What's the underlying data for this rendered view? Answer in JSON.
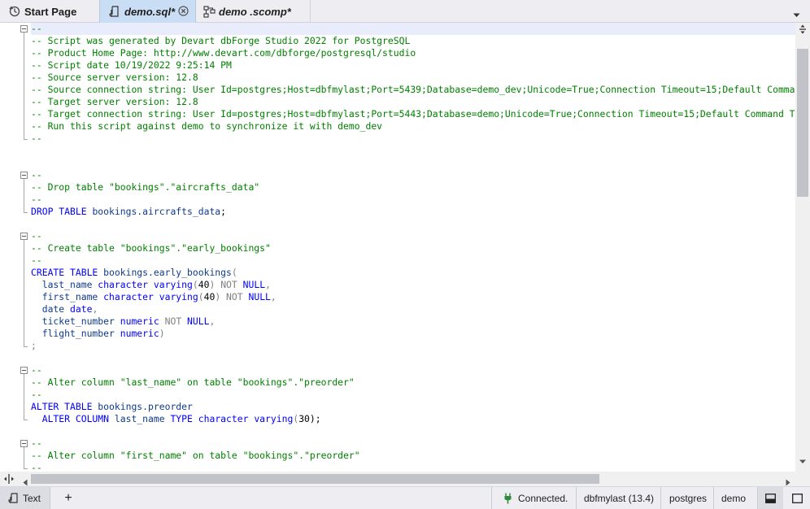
{
  "tabs": [
    {
      "label": "Start Page",
      "icon": "start-page-icon"
    },
    {
      "label": "demo.sql*",
      "icon": "sql-document-icon",
      "active": true
    },
    {
      "label": "demo .scomp*",
      "icon": "schema-compare-icon"
    }
  ],
  "editor": {
    "lines": [
      [
        {
          "t": "--",
          "c": "cm"
        }
      ],
      [
        {
          "t": "-- Script was generated by Devart dbForge Studio 2022 for PostgreSQL",
          "c": "cm"
        }
      ],
      [
        {
          "t": "-- Product Home Page: http://www.devart.com/dbforge/postgresql/studio",
          "c": "cm"
        }
      ],
      [
        {
          "t": "-- Script date 10/19/2022 9:25:14 PM",
          "c": "cm"
        }
      ],
      [
        {
          "t": "-- Source server version: 12.8",
          "c": "cm"
        }
      ],
      [
        {
          "t": "-- Source connection string: User Id=postgres;Host=dbfmylast;Port=5439;Database=demo_dev;Unicode=True;Connection Timeout=15;Default Comman",
          "c": "cm"
        }
      ],
      [
        {
          "t": "-- Target server version: 12.8",
          "c": "cm"
        }
      ],
      [
        {
          "t": "-- Target connection string: User Id=postgres;Host=dbfmylast;Port=5443;Database=demo;Unicode=True;Connection Timeout=15;Default Command Ti",
          "c": "cm"
        }
      ],
      [
        {
          "t": "-- Run this script against demo to synchronize it with demo_dev",
          "c": "cm"
        }
      ],
      [
        {
          "t": "--",
          "c": "cm"
        }
      ],
      [],
      [],
      [
        {
          "t": "--",
          "c": "cm"
        }
      ],
      [
        {
          "t": "-- Drop table \"bookings\".\"aircrafts_data\"",
          "c": "cm"
        }
      ],
      [
        {
          "t": "--",
          "c": "cm"
        }
      ],
      [
        {
          "t": "DROP TABLE ",
          "c": "kw"
        },
        {
          "t": "bookings.aircrafts_data",
          "c": "ob"
        },
        {
          "t": ";",
          "c": "pn"
        }
      ],
      [],
      [
        {
          "t": "--",
          "c": "cm"
        }
      ],
      [
        {
          "t": "-- Create table \"bookings\".\"early_bookings\"",
          "c": "cm"
        }
      ],
      [
        {
          "t": "--",
          "c": "cm"
        }
      ],
      [
        {
          "t": "CREATE TABLE ",
          "c": "kw"
        },
        {
          "t": "bookings.early_bookings",
          "c": "ob"
        },
        {
          "t": "(",
          "c": "gr"
        }
      ],
      [
        {
          "t": "  last_name ",
          "c": "ob"
        },
        {
          "t": "character varying",
          "c": "kw"
        },
        {
          "t": "(",
          "c": "gr"
        },
        {
          "t": "40",
          "c": "nm"
        },
        {
          "t": ") ",
          "c": "gr"
        },
        {
          "t": "NOT ",
          "c": "gr"
        },
        {
          "t": "NULL",
          "c": "kw"
        },
        {
          "t": ",",
          "c": "gr"
        }
      ],
      [
        {
          "t": "  first_name ",
          "c": "ob"
        },
        {
          "t": "character varying",
          "c": "kw"
        },
        {
          "t": "(",
          "c": "gr"
        },
        {
          "t": "40",
          "c": "nm"
        },
        {
          "t": ") ",
          "c": "gr"
        },
        {
          "t": "NOT ",
          "c": "gr"
        },
        {
          "t": "NULL",
          "c": "kw"
        },
        {
          "t": ",",
          "c": "gr"
        }
      ],
      [
        {
          "t": "  date ",
          "c": "ob"
        },
        {
          "t": "date",
          "c": "kw"
        },
        {
          "t": ",",
          "c": "gr"
        }
      ],
      [
        {
          "t": "  ticket_number ",
          "c": "ob"
        },
        {
          "t": "numeric ",
          "c": "kw"
        },
        {
          "t": "NOT ",
          "c": "gr"
        },
        {
          "t": "NULL",
          "c": "kw"
        },
        {
          "t": ",",
          "c": "gr"
        }
      ],
      [
        {
          "t": "  flight_number ",
          "c": "ob"
        },
        {
          "t": "numeric",
          "c": "kw"
        },
        {
          "t": ")",
          "c": "gr"
        }
      ],
      [
        {
          "t": ";",
          "c": "gr"
        }
      ],
      [],
      [
        {
          "t": "--",
          "c": "cm"
        }
      ],
      [
        {
          "t": "-- Alter column \"last_name\" on table \"bookings\".\"preorder\"",
          "c": "cm"
        }
      ],
      [
        {
          "t": "--",
          "c": "cm"
        }
      ],
      [
        {
          "t": "ALTER TABLE ",
          "c": "kw"
        },
        {
          "t": "bookings.preorder",
          "c": "ob"
        }
      ],
      [
        {
          "t": "  ALTER COLUMN ",
          "c": "kw"
        },
        {
          "t": "last_name ",
          "c": "ob"
        },
        {
          "t": "TYPE ",
          "c": "kw"
        },
        {
          "t": "character varying",
          "c": "kw"
        },
        {
          "t": "(",
          "c": "gr"
        },
        {
          "t": "30",
          "c": "nm"
        },
        {
          "t": ");",
          "c": "pn"
        }
      ],
      [],
      [
        {
          "t": "--",
          "c": "cm"
        }
      ],
      [
        {
          "t": "-- Alter column \"first_name\" on table \"bookings\".\"preorder\"",
          "c": "cm"
        }
      ],
      [
        {
          "t": "--",
          "c": "cm"
        }
      ]
    ]
  },
  "statusbar": {
    "text_tab": "Text",
    "add": "+",
    "connection": "Connected.",
    "server": "dbfmylast (13.4)",
    "user": "postgres",
    "database": "demo",
    "colors": {
      "connected_icon": "#2e8b3a"
    }
  }
}
